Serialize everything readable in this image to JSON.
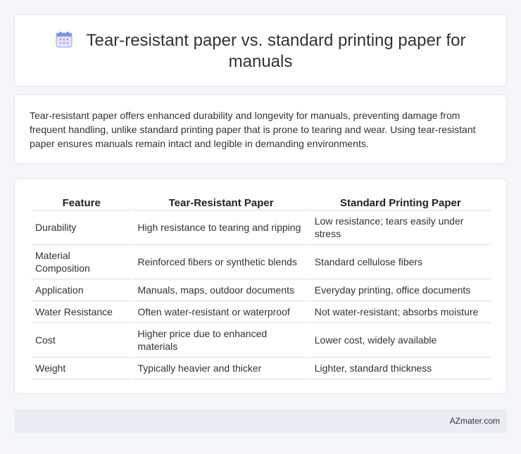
{
  "header": {
    "title": "Tear-resistant paper vs. standard printing paper for manuals",
    "icon": "calendar-icon",
    "icon_color": "#6f8ff0"
  },
  "summary": {
    "text": "Tear-resistant paper offers enhanced durability and longevity for manuals, preventing damage from frequent handling, unlike standard printing paper that is prone to tearing and wear. Using tear-resistant paper ensures manuals remain intact and legible in demanding environments."
  },
  "table": {
    "headers": [
      "Feature",
      "Tear-Resistant Paper",
      "Standard Printing Paper"
    ],
    "rows": [
      [
        "Durability",
        "High resistance to tearing and ripping",
        "Low resistance; tears easily under stress"
      ],
      [
        "Material Composition",
        "Reinforced fibers or synthetic blends",
        "Standard cellulose fibers"
      ],
      [
        "Application",
        "Manuals, maps, outdoor documents",
        "Everyday printing, office documents"
      ],
      [
        "Water Resistance",
        "Often water-resistant or waterproof",
        "Not water-resistant; absorbs moisture"
      ],
      [
        "Cost",
        "Higher price due to enhanced materials",
        "Lower cost, widely available"
      ],
      [
        "Weight",
        "Typically heavier and thicker",
        "Lighter, standard thickness"
      ]
    ]
  },
  "footer": {
    "text": "AZmater.com"
  }
}
